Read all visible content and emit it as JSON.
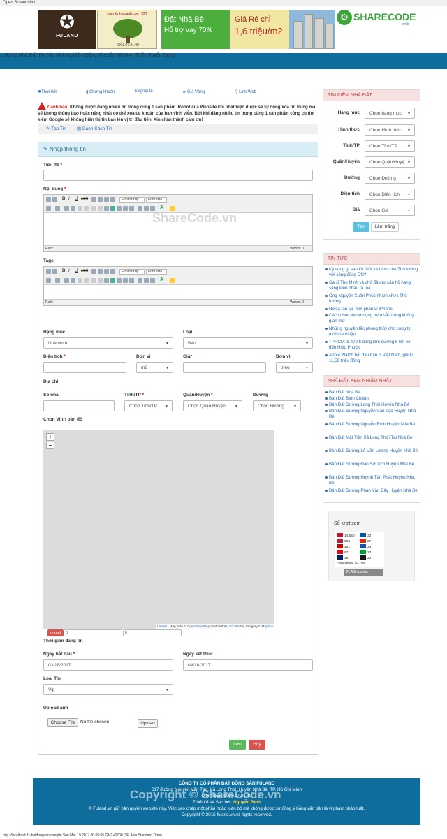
{
  "window": {
    "title": "Open Screenshot"
  },
  "header": {
    "logo_text": "FULAND",
    "ad1": {
      "headline": "Làm kinh doanh cực HOT",
      "phone": "0903.07.01.49"
    },
    "ad2": {
      "line1": "Đất Nhà Bè",
      "line2": "Hỗ trợ vay 70%"
    },
    "ad3": {
      "line1": "Giá Rẻ chỉ",
      "line2": "1,6 triệu/m2"
    },
    "brand": {
      "name": "SHARECODE",
      "suffix": "web"
    }
  },
  "nav": {
    "items": [
      "Home",
      "Nhà Đất",
      "Tin Tức",
      "Kinh Nghiệm",
      "Đăng Tin",
      "Liên Hệ",
      "Giới Thiệu",
      "Tuyển Dụng"
    ]
  },
  "quicklinks": [
    "Thời tiết",
    "Chứng khoán",
    "Ngoại tệ",
    "Giá Vàng",
    "Link Web"
  ],
  "warning": {
    "label": "Cảnh báo:",
    "text": "Không được đăng nhiều tin trong cùng 1 sản phẩm. Robot của Website khi phát hiện được sẽ tự động xóa tin trùng mà sẽ không thông báo hoặc nặng nhất có thể xóa tài khoản của bạn vĩnh viễn. Bởi khi đăng nhiều tin trong cùng 1 sản phẩm công cụ tìm kiếm Google sẽ không hiển thị tin bạn lên vị trí đầu tiên. Xin chân thành cảm ơn!"
  },
  "subnav": {
    "create": "Tạo Tin",
    "list": "Danh Sách Tin"
  },
  "form": {
    "panel_title": "Nhập thông tin",
    "title_label": "Tiêu đề",
    "content_label": "Nội dung",
    "tags_label": "Tags",
    "editor": {
      "font_family": "Font family",
      "font_size": "Font size",
      "path": "Path:",
      "words": "Words: 0"
    },
    "category_label": "Hạng mục",
    "category_value": "Nhà vườn",
    "type_label": "Loại",
    "type_value": "Bán",
    "area_label": "Diện tích",
    "unit_label": "Đơn vị",
    "area_unit_value": "m2",
    "price_label": "Giá",
    "price_unit_label": "Đơn vị",
    "price_unit_value": "triệu",
    "address_label": "Địa chỉ",
    "house_label": "Số nhà",
    "province_label": "Tỉnh/TP",
    "province_value": "Chọn Tỉnh/TP",
    "district_label": "Quận/Huyện",
    "district_value": "Chọn Quận/Huyện",
    "street_label": "Đường",
    "street_value": "Chọn Đường",
    "map_label": "Chọn Vị trí bản đồ",
    "map_zoom_in": "+",
    "map_zoom_out": "−",
    "map_attribution": {
      "leaflet": "Leaflet",
      "mid": " | Map data © ",
      "osm": "OpenStreetMap",
      "contrib": " contributors, ",
      "ccby": "CC-BY-SA",
      "imagery": ", Imagery © ",
      "mapbox": "Mapbox"
    },
    "reload": "reload",
    "lat_value": "0",
    "lng_value": "0",
    "post_time_label": "Thời gian đăng tin",
    "start_label": "Ngày bắt đầu",
    "start_value": "03/18/2017",
    "end_label": "Ngày kết thúc",
    "end_value": "04/18/2017",
    "listing_type_label": "Loại Tin",
    "listing_type_value": "Vip",
    "upload_label": "Upload ảnh",
    "choose_file": "Choose File",
    "no_file": "No file chosen",
    "upload_button": "Upload",
    "save": "Lưu",
    "cancel": "Hủy"
  },
  "search": {
    "title": "TÌM KIẾM NHÀ ĐẤT",
    "rows": [
      {
        "label": "Hạng mục",
        "value": "Chọn hạng mục"
      },
      {
        "label": "Hình thức",
        "value": "Chọn Hình thức"
      },
      {
        "label": "Tỉnh/TP",
        "value": "Chọn Tỉnh/TP"
      },
      {
        "label": "Quận/Huyện",
        "value": "Chọn Quận/Huyệ"
      },
      {
        "label": "Đường",
        "value": "Chọn Đường"
      },
      {
        "label": "Diện tích",
        "value": "Chọn Diện tích"
      },
      {
        "label": "Giá",
        "value": "Chọn Giá"
      }
    ],
    "search_button": "Tìm",
    "reset_button": "Làm trắng"
  },
  "news": {
    "title": "TIN TỨC",
    "items": [
      "Kỳ vọng gì sau lời 'Nói và Làm' của Thủ tướng với cộng đồng DN?",
      "Ca sĩ Thu Minh và chủ đầu tư căn hộ hạng sang kiện nhau ra toà",
      "Ông Nguyễn Xuân Phúc nhậm chức Thủ tướng",
      "Nokia tàn lụi, một phần vì iPhone",
      "Cách chọn và sử dụng màu sắc trong không gian mở",
      "Những nguyên tắc phong thủy cho công ty mới thành lập",
      "TPHCM: 8.470 tỉ đồng làm đường 6 làn xe đến Hiệp Phước",
      "Apple Watch bắt đầu bán ở Việt Nam, giá từ 11,59 triệu đồng"
    ]
  },
  "popular": {
    "title": "NHÀ ĐẤT XEM NHIỀU NHẤT",
    "items": [
      "Bán Đất Nhà Bè",
      "Bán Đất Bình Chánh",
      "Bán Đất Đường Long Thới Huyện Nhà Bè",
      "Bán Đất Đường Nguyễn Văn Tạo Huyện Nhà Bè",
      "Bán Đất Đường Nguyễn Bình Huyện Nhà Bè",
      "Bán Đất Mặt Tiền Xã Long Thới Tại Nhà Bè",
      "Bán Đất Đường Lê Văn Lương Huyện Nhà Bè",
      "Bán Đất Đường Đào Sư Tích Huyện Nhà Bè",
      "Bán Đất Đường Huỳnh Tấn Phát Huyện Nhà Bè",
      "Bán Đất Đường Phan Văn Bảy Huyện Nhà Bè"
    ]
  },
  "counter": {
    "title": "Số lượt xem",
    "left": [
      {
        "v": "14,550",
        "c": "#c8102e"
      },
      {
        "v": "953",
        "c": "#b22234"
      },
      {
        "v": "181",
        "c": "#cc0000"
      },
      {
        "v": "87",
        "c": "#e30a17"
      },
      {
        "v": "38",
        "c": "#012169"
      }
    ],
    "right": [
      {
        "v": "32",
        "c": "#0055a4"
      },
      {
        "v": "27",
        "c": "#de2910"
      },
      {
        "v": "23",
        "c": "#1a4fb0"
      },
      {
        "v": "23",
        "c": "#009c3b"
      },
      {
        "v": "22",
        "c": "#1a1a1a"
      }
    ],
    "pageviews": "Pageviews: 83,764",
    "brand": "FLAG counter"
  },
  "footer": {
    "company": "CÔNG TY CỔ PHẦN BẤT ĐỘNG SẢN FULAND",
    "address": "617 đường Nguyễn Văn Tạo, Xã Long Thới, Huyện Nhà Bè, TP. Hồ Chí Minh",
    "contact": "Điện thoại: 0903.07.01.49",
    "designer_prefix": "Thiết kế và Seo bởi:",
    "designer": "Nguyễn Bình",
    "copyright_notice": "® Fuland.vn giữ bản quyền website này. Việc sao chép một phần hoặc toàn bộ mà không được sử đồng ý bằng văn bản là vi phạm pháp luật.",
    "copyright": "Copyright © 2015 fuland.vn All rights reserved."
  },
  "watermarks": {
    "mid": "ShareCode.vn",
    "bottom": "Copyright © ShareCode.vn"
  },
  "status_bar": "http://localhost:81/batdongsan/dangtin Sun Mar 19 2017 00:05:05 GMT+0700 (SE Asia Standard Time)",
  "colors": {
    "nav": "#0e6d9c",
    "link": "#2a6cb2",
    "danger": "#d9231d",
    "success": "#5cb85c",
    "info": "#5bc0de"
  }
}
